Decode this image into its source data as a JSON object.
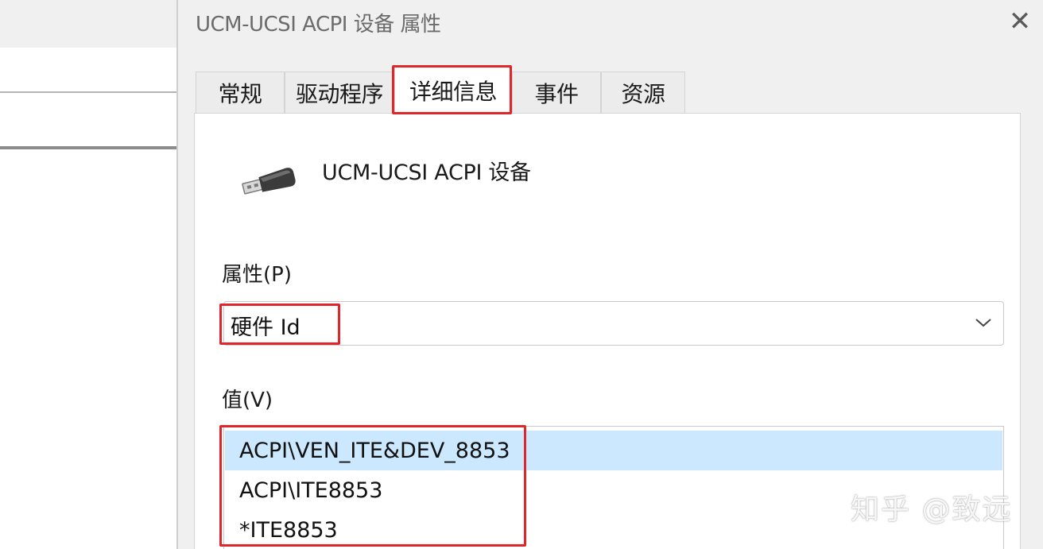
{
  "dialog": {
    "title": "UCM-UCSI ACPI 设备 属性",
    "close_label": "✕"
  },
  "tabs": [
    {
      "label": "常规",
      "active": false
    },
    {
      "label": "驱动程序",
      "active": false
    },
    {
      "label": "详细信息",
      "active": true
    },
    {
      "label": "事件",
      "active": false
    },
    {
      "label": "资源",
      "active": false
    }
  ],
  "device": {
    "icon": "usb-connector-icon",
    "name": "UCM-UCSI ACPI 设备"
  },
  "property": {
    "label": "属性(P)",
    "selected_value": "硬件 Id"
  },
  "value": {
    "label": "值(V)",
    "items": [
      {
        "text": "ACPI\\VEN_ITE&DEV_8853",
        "selected": true
      },
      {
        "text": "ACPI\\ITE8853",
        "selected": false
      },
      {
        "text": "*ITE8853",
        "selected": false
      }
    ]
  },
  "colors": {
    "highlight": "#e0262a",
    "selection": "#cce8ff"
  },
  "watermark": "知乎 @致远"
}
